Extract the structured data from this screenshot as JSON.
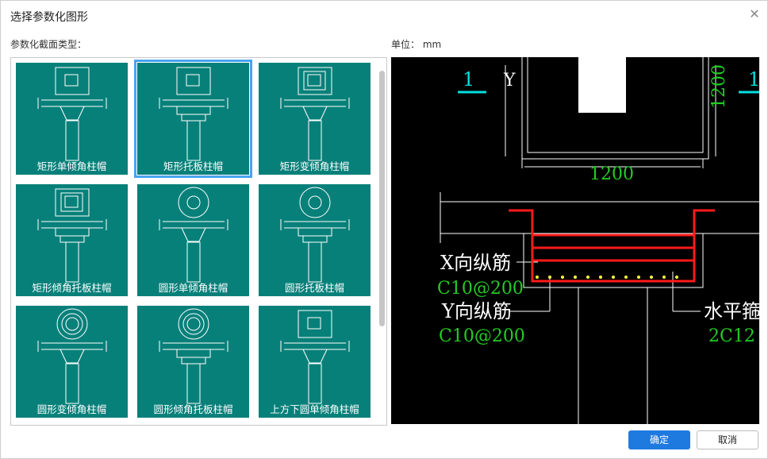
{
  "dialog": {
    "title": "选择参数化图形",
    "close_icon": "close-icon"
  },
  "gallery": {
    "label": "参数化截面类型：",
    "items": [
      {
        "label": "矩形单倾角柱帽",
        "cap": "square",
        "plate": false,
        "selected": false
      },
      {
        "label": "矩形托板柱帽",
        "cap": "square",
        "plate": true,
        "selected": true
      },
      {
        "label": "矩形变倾角柱帽",
        "cap": "square-double",
        "plate": false,
        "selected": false
      },
      {
        "label": "矩形倾角托板柱帽",
        "cap": "square-double",
        "plate": true,
        "selected": false
      },
      {
        "label": "圆形单倾角柱帽",
        "cap": "circle",
        "plate": false,
        "selected": false
      },
      {
        "label": "圆形托板柱帽",
        "cap": "circle",
        "plate": true,
        "selected": false
      },
      {
        "label": "圆形变倾角柱帽",
        "cap": "circle-double",
        "plate": false,
        "selected": false
      },
      {
        "label": "圆形倾角托板柱帽",
        "cap": "circle-double",
        "plate": true,
        "selected": false
      },
      {
        "label": "上方下圆单倾角柱帽",
        "cap": "square",
        "plate": false,
        "selected": false
      }
    ]
  },
  "preview": {
    "unit_label": "单位：  mm",
    "section_mark_left": "1",
    "section_mark_right": "1",
    "y_label": "Y",
    "dim_vertical": "1200",
    "dim_horizontal": "1200",
    "x_rebar_label": "X向纵筋",
    "x_rebar_value": "C10@200",
    "y_rebar_label": "Y向纵筋",
    "y_rebar_value": "C10@200",
    "horiz_rebar_label": "水平箍",
    "horiz_rebar_value": "2C12"
  },
  "buttons": {
    "ok": "确定",
    "cancel": "取消"
  },
  "colors": {
    "tile_bg": "#08807a",
    "selected_border": "#4aa3f0",
    "ok_button": "#1f7ae0",
    "cad_green": "#22cc22",
    "cad_cyan": "#00e0e0",
    "cad_red": "#ff1a1a",
    "cad_yellow": "#ffff40"
  }
}
